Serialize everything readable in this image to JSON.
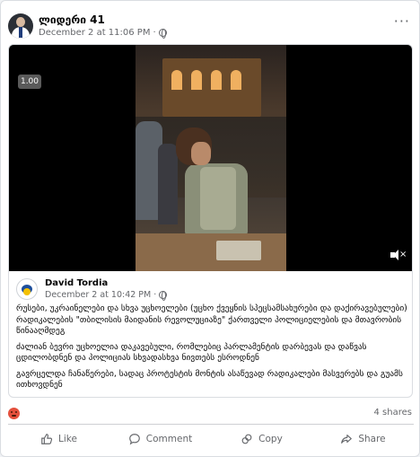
{
  "post": {
    "page_name": "ლიდერი 41",
    "timestamp": "December 2 at 11:06 PM",
    "audience_icon": "globe-icon"
  },
  "video": {
    "speed_badge": "1.00",
    "muted_icon": "speaker-muted-icon"
  },
  "shared_post": {
    "author": "David Tordia",
    "timestamp": "December 2 at 10:42 PM",
    "paragraphs": [
      "რუსები, უკრაინელები და სხვა უცხოელები (უცხო ქვეყნის სპეცსამსახურები და დაქირავებულები) რადიკალების \"თბილისის მაიდანის რევოლუციაზე\" ქართველი პოლიციელების და მთავრობის წინააღმდეგ",
      "ძალიან ბევრი უცხოელია დაკავებული, რომლებიც პარლამენტის დარბევას და დაწვას ცდილობდნენ და პოლიციას სხვადასხვა ნივთებს ესროდნენ",
      "გავრცელდა ჩანაწერები, სადაც პროტესტის მონტის ასაწევად რადიკალები მასვერებს და გუამს ითხოვდნენ"
    ]
  },
  "stats": {
    "shares": "4 shares"
  },
  "actions": {
    "like": "Like",
    "comment": "Comment",
    "copy": "Copy",
    "share": "Share"
  }
}
